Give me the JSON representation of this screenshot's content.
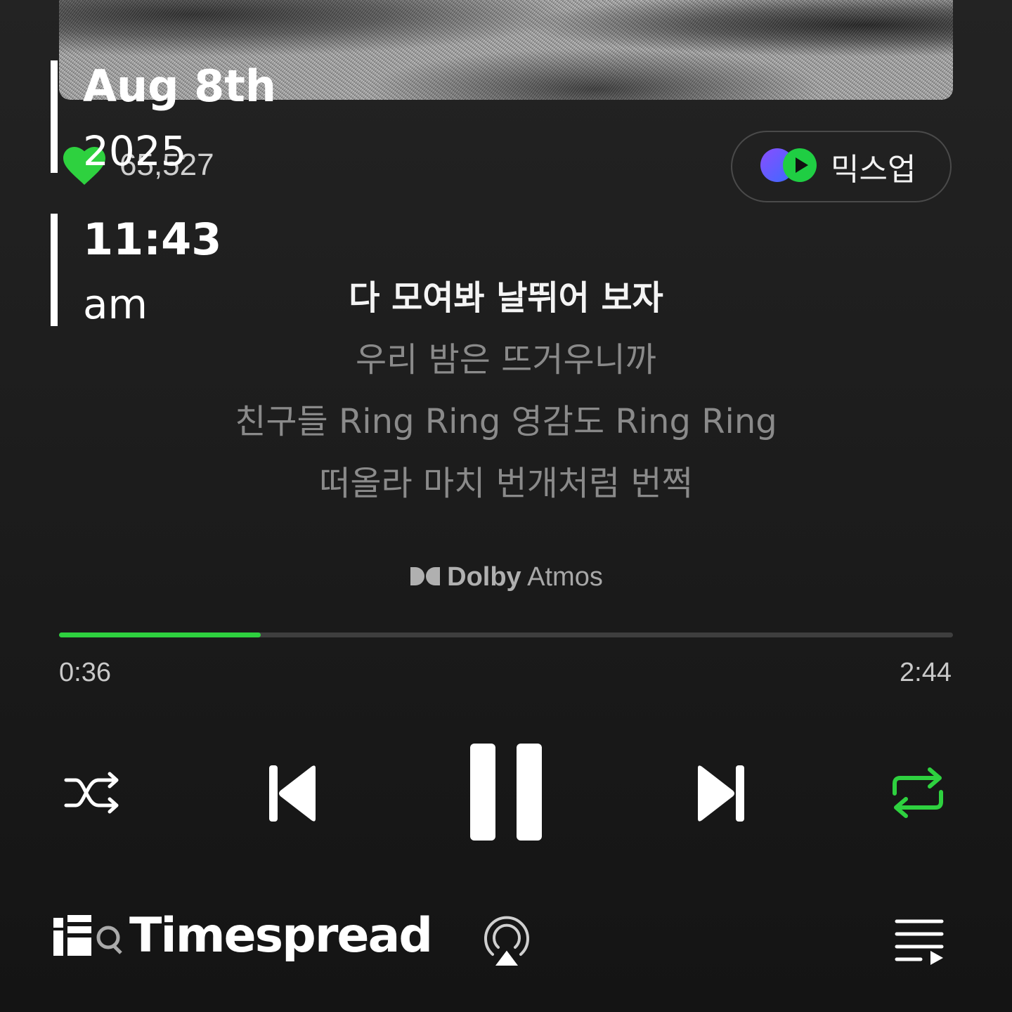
{
  "overlay": {
    "date_line1": "Aug 8th",
    "date_line2": "2025",
    "time_line1": "11:43",
    "time_line2": "am"
  },
  "track": {
    "like_count": "65,527",
    "liked": true
  },
  "mixup": {
    "label": "믹스업"
  },
  "lyrics": [
    "다 모여봐 날뛰어 보자",
    "우리 밤은 뜨거우니까",
    "친구들 Ring Ring 영감도 Ring Ring",
    "떠올라 마치 번개처럼 번쩍"
  ],
  "lyrics_current_index": 0,
  "audio_badge": {
    "brand": "Dolby",
    "format": "Atmos"
  },
  "playback": {
    "elapsed": "0:36",
    "total": "2:44",
    "progress_fraction": 0.2256,
    "is_playing": true,
    "repeat_on": true,
    "shuffle_on": false
  },
  "watermark": {
    "text": "Timespread"
  },
  "colors": {
    "accent_green": "#2ed13f",
    "background": "#1c1c1c"
  },
  "icons": {
    "like": "heart-icon",
    "mixup": "mixup-logo-icon",
    "shuffle": "shuffle-icon",
    "previous": "skip-previous-icon",
    "pause": "pause-icon",
    "next": "skip-next-icon",
    "repeat": "repeat-icon",
    "cast": "airplay-icon",
    "queue": "queue-icon"
  }
}
